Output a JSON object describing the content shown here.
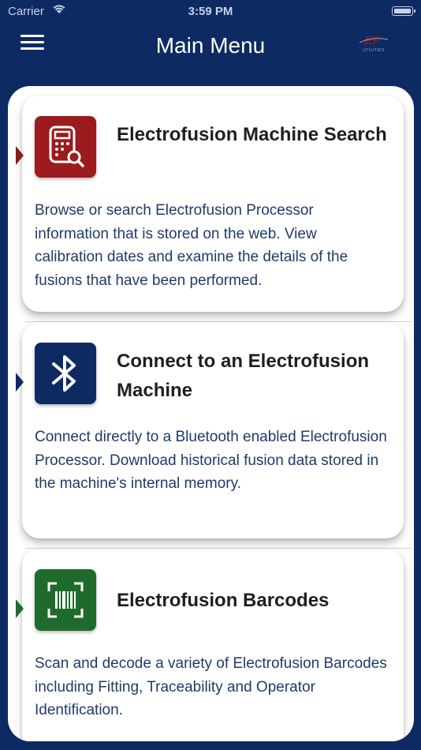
{
  "status_bar": {
    "carrier": "Carrier",
    "time": "3:59 PM"
  },
  "navbar": {
    "title": "Main Menu",
    "logo_text": "EF",
    "logo_subtext": "UTILITIES"
  },
  "colors": {
    "background": "#0d2a63",
    "red": "#9b1b1e",
    "blue": "#0d2a63",
    "green": "#1f6b2d"
  },
  "menu_items": [
    {
      "title": "Electrofusion Machine Search",
      "description": "Browse or search Electrofusion Processor information that is stored on the web. View calibration dates and examine the details of the fusions that have been performed.",
      "icon": "calculator-search-icon",
      "color": "#9b1b1e"
    },
    {
      "title": "Connect to an Electrofusion Machine",
      "description": "Connect directly to a Bluetooth enabled Electrofusion Processor. Download historical fusion data stored in the machine's internal memory.",
      "icon": "bluetooth-icon",
      "color": "#0d2a63"
    },
    {
      "title": "Electrofusion Barcodes",
      "description": "Scan and decode a variety of Electrofusion Barcodes including Fitting, Traceability and Operator Identification.",
      "icon": "barcode-scan-icon",
      "color": "#1f6b2d"
    }
  ]
}
